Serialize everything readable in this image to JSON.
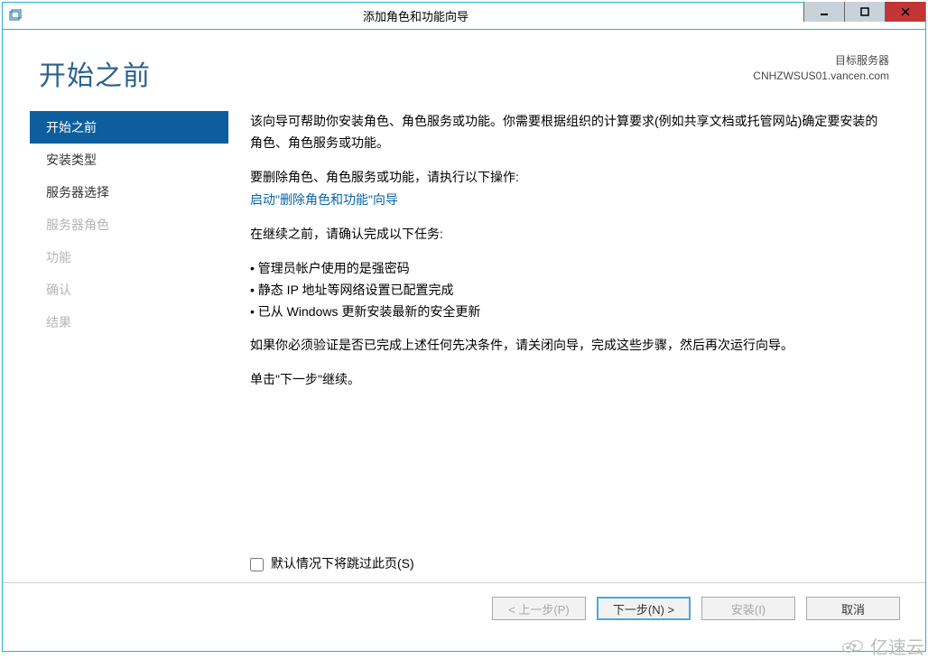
{
  "titlebar": {
    "title": "添加角色和功能向导"
  },
  "header": {
    "page_title": "开始之前",
    "target_label": "目标服务器",
    "target_server": "CNHZWSUS01.vancen.com"
  },
  "sidebar": {
    "items": [
      {
        "label": "开始之前",
        "state": "active"
      },
      {
        "label": "安装类型",
        "state": "normal"
      },
      {
        "label": "服务器选择",
        "state": "normal"
      },
      {
        "label": "服务器角色",
        "state": "disabled"
      },
      {
        "label": "功能",
        "state": "disabled"
      },
      {
        "label": "确认",
        "state": "disabled"
      },
      {
        "label": "结果",
        "state": "disabled"
      }
    ]
  },
  "content": {
    "intro": "该向导可帮助你安装角色、角色服务或功能。你需要根据组织的计算要求(例如共享文档或托管网站)确定要安装的角色、角色服务或功能。",
    "remove_prompt": "要删除角色、角色服务或功能，请执行以下操作:",
    "remove_link": "启动\"删除角色和功能\"向导",
    "confirm_prompt": "在继续之前，请确认完成以下任务:",
    "tasks": [
      "管理员帐户使用的是强密码",
      "静态 IP 地址等网络设置已配置完成",
      "已从 Windows 更新安装最新的安全更新"
    ],
    "verify": "如果你必须验证是否已完成上述任何先决条件，请关闭向导，完成这些步骤，然后再次运行向导。",
    "continue_hint": "单击\"下一步\"继续。",
    "skip_label": "默认情况下将跳过此页(S)"
  },
  "buttons": {
    "prev": "< 上一步(P)",
    "next": "下一步(N) >",
    "install": "安装(I)",
    "cancel": "取消"
  },
  "watermark": "亿速云"
}
